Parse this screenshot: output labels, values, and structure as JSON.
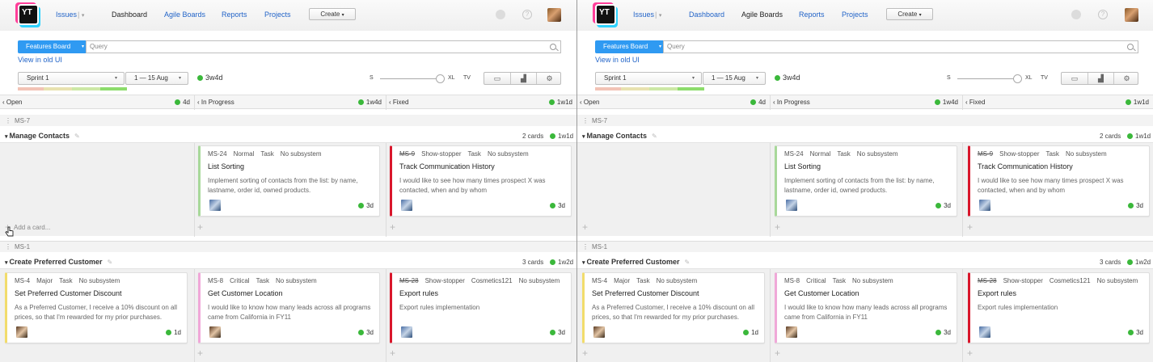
{
  "logo_text": "YT",
  "nav": {
    "issues": "Issues",
    "dashboard": "Dashboard",
    "agile_boards": "Agile Boards",
    "reports": "Reports",
    "projects": "Projects",
    "create": "Create"
  },
  "search": {
    "board": "Features Board",
    "placeholder": "Query"
  },
  "old_ui_link": "View in old UI",
  "sprint": {
    "name": "Sprint 1",
    "dates": "1 — 15 Aug",
    "estimate": "3w4d"
  },
  "size": {
    "s": "S",
    "xl": "XL",
    "tv": "TV"
  },
  "columns": [
    {
      "name": "Open",
      "estimate": "4d"
    },
    {
      "name": "In Progress",
      "estimate": "1w4d"
    },
    {
      "name": "Fixed",
      "estimate": "1w1d"
    }
  ],
  "add_card": "Add a card...",
  "swimlanes": [
    {
      "id": "MS-7",
      "title": "Manage Contacts",
      "count": "2 cards",
      "estimate": "1w1d",
      "cards": [
        {
          "id": "MS-24",
          "priority": "Normal",
          "type": "Task",
          "subsystem": "No subsystem",
          "title": "List Sorting",
          "desc": "Implement sorting of contacts from the list: by name, lastname, order id, owned products.",
          "estimate": "3d",
          "resolved": false
        },
        {
          "id": "MS-9",
          "priority": "Show-stopper",
          "type": "Task",
          "subsystem": "No subsystem",
          "title": "Track Communication History",
          "desc": "I would like to see how many times prospect X was contacted, when and by whom",
          "estimate": "3d",
          "resolved": true
        }
      ]
    },
    {
      "id": "MS-1",
      "title": "Create Preferred Customer",
      "count": "3 cards",
      "estimate": "1w2d",
      "cards": [
        {
          "id": "MS-4",
          "priority": "Major",
          "type": "Task",
          "subsystem": "No subsystem",
          "title": "Set Preferred Customer Discount",
          "desc": "As a Preferred Customer, I receive a 10% discount on all prices, so that I'm rewarded for my prior purchases.",
          "estimate": "1d",
          "resolved": false
        },
        {
          "id": "MS-8",
          "priority": "Critical",
          "type": "Task",
          "subsystem": "No subsystem",
          "title": "Get Customer Location",
          "desc": "I would like to know how many leads across all programs came from California in FY11",
          "estimate": "3d",
          "resolved": false
        },
        {
          "id": "MS-28",
          "priority": "Show-stopper",
          "type": "Cosmetics121",
          "subsystem": "No subsystem",
          "title": "Export rules",
          "desc": "Export rules implementation",
          "estimate": "3d",
          "resolved": true
        }
      ]
    }
  ],
  "colors": {
    "link": "#2264c8",
    "board_button": "#2f9af2",
    "estimate_dot": "#3bb83b",
    "priority_normal": "#a8d89a",
    "priority_showstopper": "#d9162b",
    "priority_major": "#f2dc6b",
    "priority_critical": "#f0a8d8"
  }
}
